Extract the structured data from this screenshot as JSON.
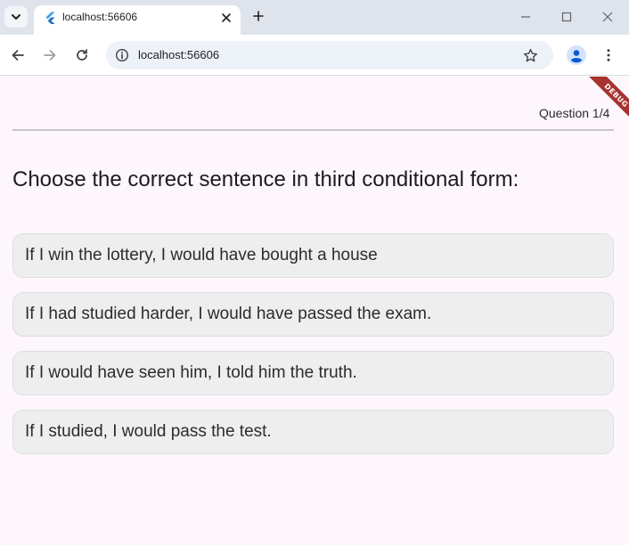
{
  "browser": {
    "tab": {
      "title": "localhost:56606"
    },
    "url": "localhost:56606"
  },
  "quiz": {
    "counter": "Question 1/4",
    "question": "Choose the correct sentence in third conditional form:",
    "options": [
      "If I win the lottery, I would have bought a house",
      "If I had studied harder, I would have passed the exam.",
      "If I would have seen him, I told him the truth.",
      "If I studied, I would pass the test."
    ]
  },
  "debug_banner": "DEBUG",
  "colors": {
    "tabstrip": "#dfe3eb",
    "content_background": "#fdf7fd",
    "option_background": "#eeeeee",
    "debug_banner": "#a8322f",
    "flutter_blue": "#45a2e8"
  },
  "icons": [
    "tab-search-icon",
    "flutter-icon",
    "close-icon",
    "plus-icon",
    "minimize-icon",
    "maximize-icon",
    "back-arrow-icon",
    "forward-arrow-icon",
    "reload-icon",
    "info-icon",
    "star-icon",
    "profile-icon",
    "kebab-menu-icon"
  ]
}
